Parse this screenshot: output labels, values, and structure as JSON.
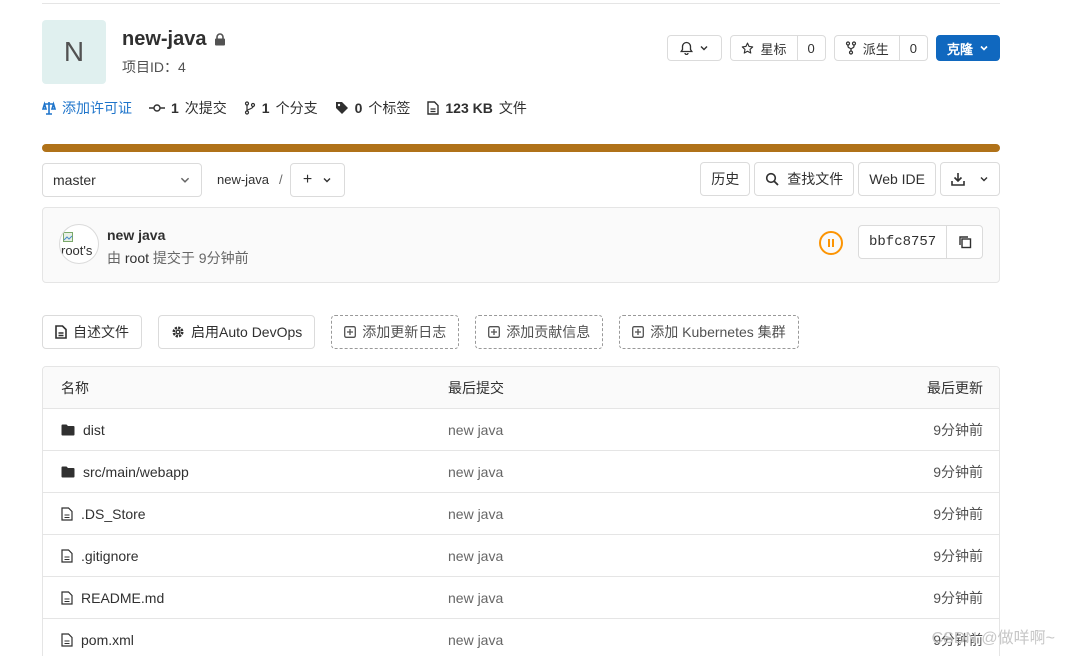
{
  "project": {
    "avatar_letter": "N",
    "name": "new-java",
    "id_label": "项目ID：4"
  },
  "header_actions": {
    "notify_icon": "bell-icon",
    "star_label": "星标",
    "star_count": "0",
    "fork_label": "派生",
    "fork_count": "0",
    "clone_label": "克隆"
  },
  "stats": {
    "license": "添加许可证",
    "commits_num": "1",
    "commits_label": "次提交",
    "branches_num": "1",
    "branches_label": "个分支",
    "tags_num": "0",
    "tags_label": "个标签",
    "size_num": "123 KB",
    "size_label": "文件"
  },
  "language_bar": {
    "color": "#b07219",
    "percent": 100
  },
  "tree": {
    "branch": "master",
    "breadcrumb": "new-java",
    "separator": "/",
    "add": "+",
    "history": "历史",
    "find_file": "查找文件",
    "web_ide": "Web IDE"
  },
  "last_commit": {
    "avatar_alt": "root's",
    "title": "new java",
    "by": "由",
    "author": "root",
    "committed": "提交于 9分钟前",
    "pipeline_status": "paused",
    "sha": "bbfc8757"
  },
  "suggestions": [
    {
      "label": "自述文件",
      "icon": "document-icon"
    },
    {
      "label": "启用Auto DevOps",
      "icon": "gear-icon"
    },
    {
      "label": "添加更新日志",
      "icon": "plus-square-icon"
    },
    {
      "label": "添加贡献信息",
      "icon": "plus-square-icon"
    },
    {
      "label": "添加 Kubernetes 集群",
      "icon": "plus-square-icon"
    }
  ],
  "files": {
    "headers": [
      "名称",
      "最后提交",
      "最后更新"
    ],
    "rows": [
      {
        "name": "dist",
        "type": "folder",
        "commit": "new java",
        "updated": "9分钟前"
      },
      {
        "name": "src/main/webapp",
        "type": "folder",
        "commit": "new java",
        "updated": "9分钟前"
      },
      {
        "name": ".DS_Store",
        "type": "file",
        "commit": "new java",
        "updated": "9分钟前"
      },
      {
        "name": ".gitignore",
        "type": "file",
        "commit": "new java",
        "updated": "9分钟前"
      },
      {
        "name": "README.md",
        "type": "file",
        "commit": "new java",
        "updated": "9分钟前"
      },
      {
        "name": "pom.xml",
        "type": "file",
        "commit": "new java",
        "updated": "9分钟前"
      }
    ]
  },
  "watermark": "CSDN @做咩啊~"
}
